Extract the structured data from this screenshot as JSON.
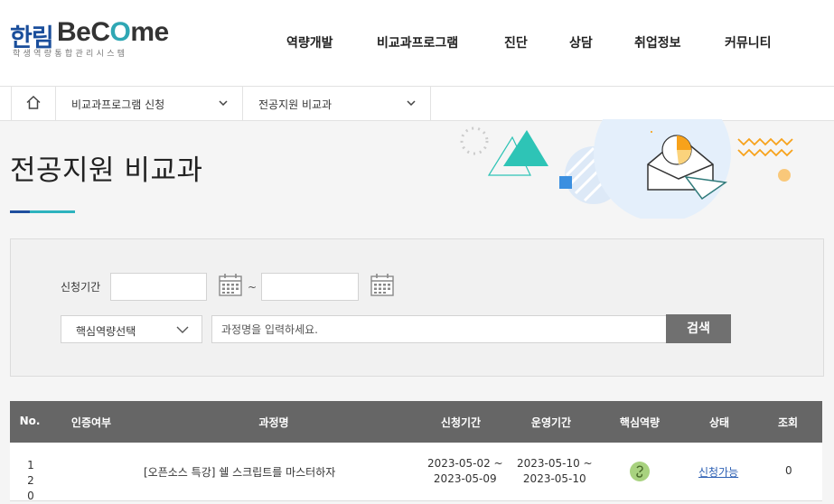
{
  "header": {
    "logo_ko": "한림",
    "logo_en_1": "BeC",
    "logo_en_2": "O",
    "logo_en_3": "me",
    "logo_sub": "학생역량통합관리시스템",
    "menu": [
      "역량개발",
      "비교과프로그램",
      "진단",
      "상담",
      "취업정보",
      "커뮤니티"
    ]
  },
  "breadcrumb": {
    "home_icon": "home-icon",
    "items": [
      "비교과프로그램 신청",
      "전공지원 비교과"
    ]
  },
  "page_title": "전공지원 비교과",
  "search": {
    "period_label": "신청기간",
    "start_value": "",
    "end_value": "",
    "tilde": "~",
    "competency_select": "핵심역량선택",
    "keyword_placeholder": "과정명을 입력하세요.",
    "search_button": "검색"
  },
  "table": {
    "headers": [
      "No.",
      "인증여부",
      "과정명",
      "신청기간",
      "운영기간",
      "핵심역량",
      "상태",
      "조회"
    ],
    "rows": [
      {
        "no": "120",
        "certified": "",
        "title": "[오픈소스 특강] 쉘 스크립트를 마스터하자",
        "apply_start": "2023-05-02 ~",
        "apply_end": "2023-05-09",
        "run_start": "2023-05-10 ~",
        "run_end": "2023-05-10",
        "competency_icon": "competency-icon",
        "status": "신청가능",
        "views": "0"
      }
    ]
  },
  "colors": {
    "brand_blue": "#1a4e9b",
    "brand_teal": "#2fa7b4",
    "table_header": "#666666",
    "status_link": "#2c5fb3"
  }
}
